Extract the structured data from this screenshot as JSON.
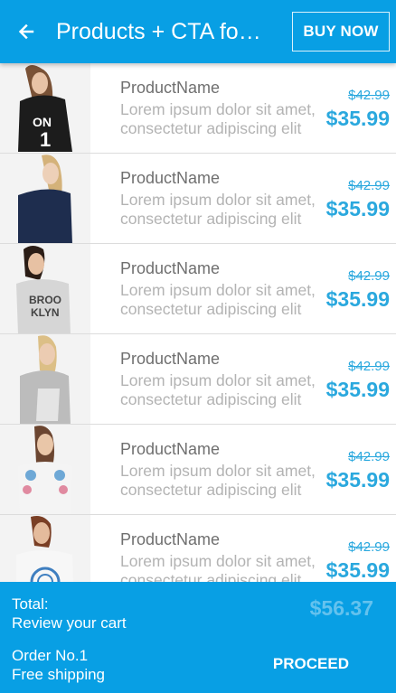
{
  "appbar": {
    "back_icon": "arrow-left-icon",
    "title": "Products + CTA foo…",
    "buy_now": "BUY NOW"
  },
  "colors": {
    "primary": "#089fe4",
    "price": "#2aa8de",
    "total_amount": "#64c2ee"
  },
  "products": [
    {
      "name": "ProductName",
      "desc1": "Lorem ipsum dolor sit amet,",
      "desc2": "consectetur adipiscing elit",
      "old_price": "$42.99",
      "price": "$35.99",
      "image": "black-jersey-shirt"
    },
    {
      "name": "ProductName",
      "desc1": "Lorem ipsum dolor sit amet,",
      "desc2": "consectetur adipiscing elit",
      "old_price": "$42.99",
      "price": "$35.99",
      "image": "navy-sweater"
    },
    {
      "name": "ProductName",
      "desc1": "Lorem ipsum dolor sit amet,",
      "desc2": "consectetur adipiscing elit",
      "old_price": "$42.99",
      "price": "$35.99",
      "image": "grey-brooklyn-shirt"
    },
    {
      "name": "ProductName",
      "desc1": "Lorem ipsum dolor sit amet,",
      "desc2": "consectetur adipiscing elit",
      "old_price": "$42.99",
      "price": "$35.99",
      "image": "grey-sweater"
    },
    {
      "name": "ProductName",
      "desc1": "Lorem ipsum dolor sit amet,",
      "desc2": "consectetur adipiscing elit",
      "old_price": "$42.99",
      "price": "$35.99",
      "image": "floral-top"
    },
    {
      "name": "ProductName",
      "desc1": "Lorem ipsum dolor sit amet,",
      "desc2": "consectetur adipiscing elit",
      "old_price": "$42.99",
      "price": "$35.99",
      "image": "white-print-tee"
    }
  ],
  "footer": {
    "total_label": "Total:",
    "review_label": "Review your cart",
    "order_label": "Order No.1",
    "shipping_label": "Free shipping",
    "total_amount": "$56.37",
    "proceed": "PROCEED"
  }
}
